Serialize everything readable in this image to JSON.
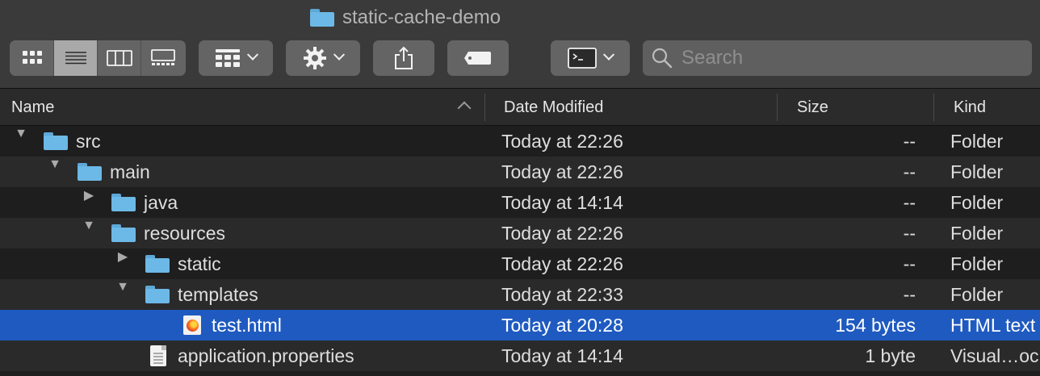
{
  "window": {
    "title": "static-cache-demo"
  },
  "toolbar": {
    "view_modes": [
      "icon-view",
      "list-view",
      "column-view",
      "gallery-view"
    ],
    "active_view": "list-view",
    "search_placeholder": "Search"
  },
  "columns": {
    "name": "Name",
    "date": "Date Modified",
    "size": "Size",
    "kind": "Kind"
  },
  "files": [
    {
      "name": "src",
      "date": "Today at 22:26",
      "size": "--",
      "kind": "Folder"
    },
    {
      "name": "main",
      "date": "Today at 22:26",
      "size": "--",
      "kind": "Folder"
    },
    {
      "name": "java",
      "date": "Today at 14:14",
      "size": "--",
      "kind": "Folder"
    },
    {
      "name": "resources",
      "date": "Today at 22:26",
      "size": "--",
      "kind": "Folder"
    },
    {
      "name": "static",
      "date": "Today at 22:26",
      "size": "--",
      "kind": "Folder"
    },
    {
      "name": "templates",
      "date": "Today at 22:33",
      "size": "--",
      "kind": "Folder"
    },
    {
      "name": "test.html",
      "date": "Today at 20:28",
      "size": "154 bytes",
      "kind": "HTML text",
      "selected": true
    },
    {
      "name": "application.properties",
      "date": "Today at 14:14",
      "size": "1 byte",
      "kind": "Visual…oc"
    }
  ],
  "colors": {
    "selection": "#1f5ac0",
    "folder": "#6cb8e6"
  }
}
